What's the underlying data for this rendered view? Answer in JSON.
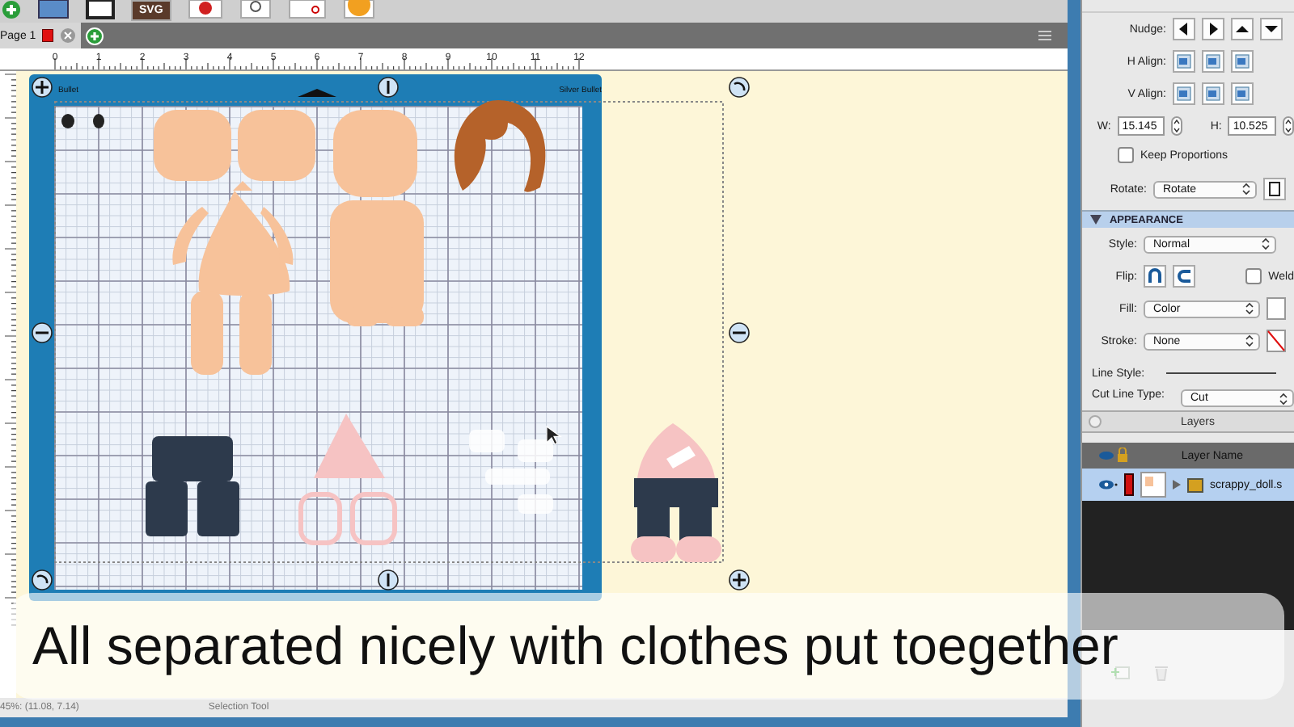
{
  "toolbar": {
    "svg_button_text": "SVG"
  },
  "tabs": [
    {
      "label": "Page 1",
      "selected": true
    }
  ],
  "ruler": {
    "labels": [
      "0",
      "1",
      "2",
      "3",
      "4",
      "5",
      "6",
      "7",
      "8",
      "9",
      "10",
      "11",
      "12"
    ]
  },
  "mat": {
    "label_left": "Bullet",
    "label_right": "Silver Bullet"
  },
  "subtitle": "All separated nicely with clothes put toegether",
  "status_bar": {
    "position": "45%: (11.08, 7.14)",
    "tool": "Selection Tool"
  },
  "properties": {
    "nudge_label": "Nudge:",
    "h_align_label": "H Align:",
    "v_align_label": "V Align:",
    "width": {
      "label": "W:",
      "value": "15.145"
    },
    "height": {
      "label": "H:",
      "value": "10.525"
    },
    "keep_proportions": {
      "label": "Keep Proportions",
      "checked": false
    },
    "rotate": {
      "label": "Rotate:",
      "value": "Rotate"
    }
  },
  "appearance": {
    "title": "APPEARANCE",
    "style": {
      "label": "Style:",
      "value": "Normal"
    },
    "flip_label": "Flip:",
    "weld": {
      "label": "Weld",
      "checked": false
    },
    "fill": {
      "label": "Fill:",
      "value": "Color"
    },
    "stroke": {
      "label": "Stroke:",
      "value": "None"
    },
    "line_style_label": "Line Style:",
    "cut_line_type": {
      "label": "Cut Line Type:",
      "value": "Cut"
    }
  },
  "layers": {
    "title": "Layers",
    "header": "Layer Name",
    "rows": [
      {
        "name": "scrappy_doll.s",
        "selected": true
      }
    ]
  }
}
